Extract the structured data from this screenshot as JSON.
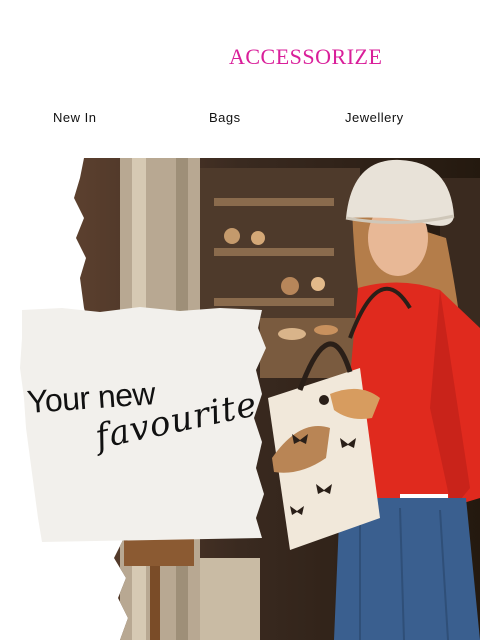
{
  "brand": {
    "logo_text": "ACCESSORIZE",
    "logo_color": "#d91f9a"
  },
  "nav": {
    "items": [
      {
        "label": "New In"
      },
      {
        "label": "Bags"
      },
      {
        "label": "Jewellery"
      }
    ]
  },
  "hero": {
    "headline_line1": "Your new",
    "headline_line2": "favourite"
  },
  "colors": {
    "sweater": "#e02a1e",
    "skirt": "#3a5f8f",
    "hat": "#e8e2d8",
    "tote": "#f1e8da"
  }
}
